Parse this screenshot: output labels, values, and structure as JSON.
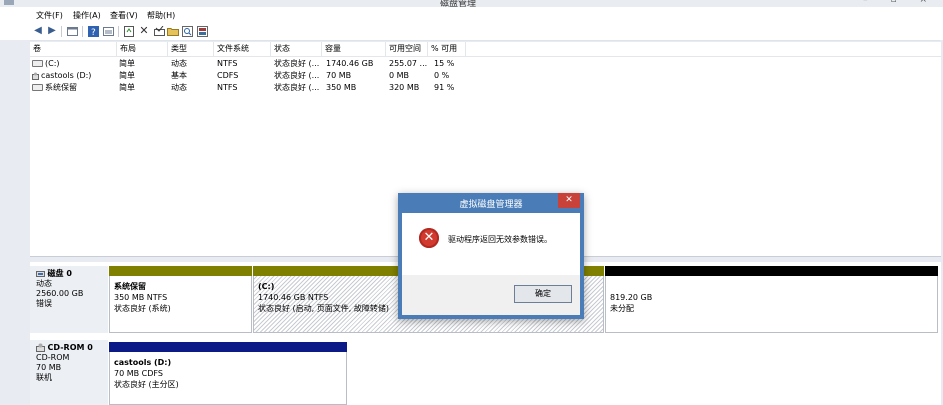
{
  "window": {
    "title": "磁盘管理",
    "controls": "– ▫ ×"
  },
  "menu": {
    "file": "文件(F)",
    "action": "操作(A)",
    "view": "查看(V)",
    "help": "帮助(H)"
  },
  "toolbar": {
    "back": "◀",
    "forward": "▶",
    "close_glyph": "✕"
  },
  "columns": [
    "卷",
    "布局",
    "类型",
    "文件系统",
    "状态",
    "容量",
    "可用空间",
    "% 可用"
  ],
  "volumes": [
    {
      "name": "(C:)",
      "layout": "简单",
      "type": "动态",
      "fs": "NTFS",
      "status": "状态良好 (...",
      "capacity": "1740.46 GB",
      "free": "255.07 ...",
      "pct": "15 %"
    },
    {
      "name": "castools (D:)",
      "layout": "简单",
      "type": "基本",
      "fs": "CDFS",
      "status": "状态良好 (...",
      "capacity": "70 MB",
      "free": "0 MB",
      "pct": "0 %"
    },
    {
      "name": "系统保留",
      "layout": "简单",
      "type": "动态",
      "fs": "NTFS",
      "status": "状态良好 (...",
      "capacity": "350 MB",
      "free": "320 MB",
      "pct": "91 %"
    }
  ],
  "disk0": {
    "name": "磁盘 0",
    "kind": "动态",
    "size": "2560.00 GB",
    "state": "错误",
    "parts": [
      {
        "title": "系统保留",
        "line1": "350 MB NTFS",
        "line2": "状态良好 (系统)"
      },
      {
        "title": "(C:)",
        "line1": "1740.46 GB NTFS",
        "line2": "状态良好 (启动, 页面文件, 故障转储)"
      },
      {
        "title": "",
        "line1": "819.20 GB",
        "line2": "未分配"
      }
    ],
    "colors": {
      "dynamic": "#808000",
      "unallocated": "#000000"
    }
  },
  "cdrom0": {
    "name": "CD-ROM 0",
    "kind": "CD-ROM",
    "size": "70 MB",
    "state": "联机",
    "part": {
      "title": "castools (D:)",
      "line1": "70 MB CDFS",
      "line2": "状态良好 (主分区)"
    },
    "colors": {
      "primary": "#0b1a86"
    }
  },
  "dialog": {
    "title": "虚拟磁盘管理器",
    "message": "驱动程序返回无效参数错误。",
    "ok": "确定",
    "close": "✕"
  }
}
